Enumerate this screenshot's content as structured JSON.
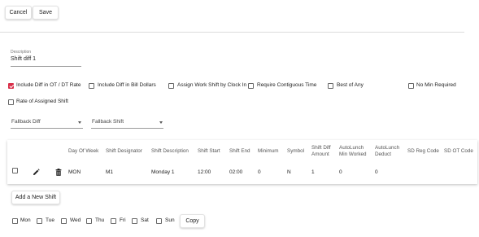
{
  "toolbar": {
    "cancel_label": "Cancel",
    "save_label": "Save"
  },
  "description": {
    "label": "Description",
    "value": "Shift diff 1"
  },
  "options": [
    {
      "label": "Include Diff in OT / DT Rate",
      "checked": true
    },
    {
      "label": "Include Diff in Bill Dollars",
      "checked": false
    },
    {
      "label": "Assign Work Shift by Clock In",
      "checked": false
    },
    {
      "label": "Require Contiguous Time",
      "checked": false
    },
    {
      "label": "Best of Any",
      "checked": false
    },
    {
      "label": "No Min Required",
      "checked": false
    },
    {
      "label": "Rate of Assigned Shift",
      "checked": false
    }
  ],
  "dropdowns": {
    "fallback_diff": "Fallback Diff",
    "fallback_shift": "Fallback Shift"
  },
  "table": {
    "headers": {
      "day_of_week": "Day Of Week",
      "shift_designator": "Shift Designator",
      "shift_description": "Shift Description",
      "shift_start": "Shift Start",
      "shift_end": "Shift End",
      "minimum": "Minimum",
      "symbol": "Symbol",
      "shift_diff_amount_1": "Shift Diff",
      "shift_diff_amount_2": "Amount",
      "autolunch_min_1": "AutoLunch",
      "autolunch_min_2": "Min Worked",
      "autolunch_deduct_1": "AutoLunch",
      "autolunch_deduct_2": "Deduct",
      "sd_reg_code": "SD Reg Code",
      "sd_ot_code": "SD OT Code"
    },
    "rows": [
      {
        "day_of_week": "MON",
        "shift_designator": "M1",
        "shift_description": "Monday 1",
        "shift_start": "12:00",
        "shift_end": "02:00",
        "minimum": "0",
        "symbol": "N",
        "shift_diff_amount": "1",
        "autolunch_min_worked": "0",
        "autolunch_deduct": "0",
        "sd_reg_code": "",
        "sd_ot_code": ""
      }
    ]
  },
  "add_shift_label": "Add a New Shift",
  "days": [
    "Mon",
    "Tue",
    "Wed",
    "Thu",
    "Fri",
    "Sat",
    "Sun"
  ],
  "copy_label": "Copy",
  "colors": {
    "checked": "#d9304a"
  }
}
